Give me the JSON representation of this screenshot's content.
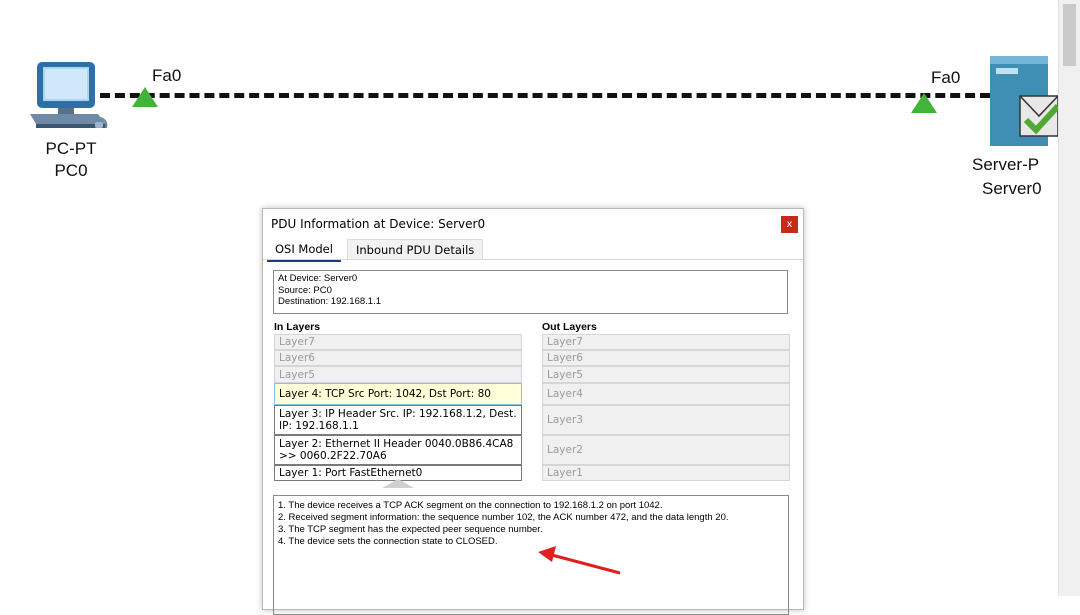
{
  "topology": {
    "pc": {
      "type_label": "PC-PT",
      "name_label": "PC0",
      "port_label": "Fa0"
    },
    "server": {
      "type_label": "Server-P",
      "name_label": "Server0",
      "port_label": "Fa0"
    },
    "link_status_color": "#43b43a"
  },
  "dialog": {
    "title": "PDU Information at Device: Server0",
    "close_label": "x",
    "tabs": [
      {
        "label": "OSI Model",
        "active": true
      },
      {
        "label": "Inbound PDU Details",
        "active": false
      }
    ],
    "info": {
      "at_device": "At Device: Server0",
      "source": "Source: PC0",
      "destination": "Destination: 192.168.1.1"
    },
    "in_layers_header": "In Layers",
    "out_layers_header": "Out Layers",
    "in_layers": [
      "Layer7",
      "Layer6",
      "Layer5",
      "Layer 4: TCP Src Port: 1042, Dst Port: 80",
      "Layer 3: IP Header Src. IP: 192.168.1.2, Dest. IP: 192.168.1.1",
      "Layer 2: Ethernet II Header 0040.0B86.4CA8 >> 0060.2F22.70A6",
      "Layer 1: Port FastEthernet0"
    ],
    "out_layers": [
      "Layer7",
      "Layer6",
      "Layer5",
      "Layer4",
      "Layer3",
      "Layer2",
      "Layer1"
    ],
    "description": [
      "1. The device receives a TCP ACK segment on the connection to 192.168.1.2 on port 1042.",
      "2. Received segment information: the sequence number 102, the ACK number 472, and the data length 20.",
      "3. The TCP segment has the expected peer sequence number.",
      "4. The device sets the connection state to CLOSED."
    ],
    "accent_color": "#1c3a7a",
    "annotation_arrow_color": "#e02020"
  }
}
